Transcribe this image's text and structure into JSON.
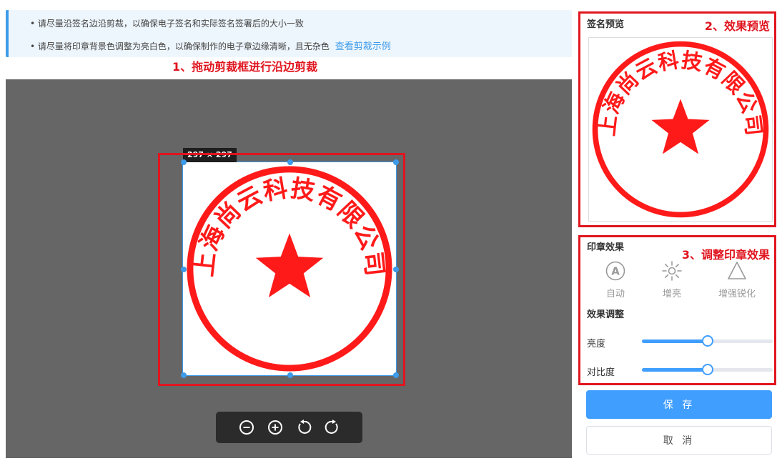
{
  "tips": {
    "line1": "• 请尽量沿签名边沿剪裁，以确保电子签名和实际签名签署后的大小一致",
    "line2": "• 请尽量将印章背景色调整为亮白色，以确保制作的电子章边缘清晰，且无杂色",
    "example_link": "查看剪裁示例"
  },
  "annotations": {
    "step1": "1、拖动剪裁框进行沿边剪裁",
    "step2": "2、效果预览",
    "step3": "3、调整印章效果"
  },
  "crop": {
    "dimensions": "297 × 297"
  },
  "seal": {
    "text": "上海尚云科技有限公司",
    "color": "#ff1a1a"
  },
  "toolbar": {
    "tools": [
      "zoom-out-icon",
      "zoom-in-icon",
      "rotate-left-icon",
      "rotate-right-icon"
    ]
  },
  "preview": {
    "title": "签名预览"
  },
  "effects": {
    "title": "印章效果",
    "options": [
      {
        "label": "自动",
        "icon": "auto-a-icon"
      },
      {
        "label": "增亮",
        "icon": "brightness-icon"
      },
      {
        "label": "增强锐化",
        "icon": "sharpen-triangle-icon"
      }
    ],
    "adjust_title": "效果调整",
    "brightness": {
      "label": "亮度",
      "value": 0.5
    },
    "contrast": {
      "label": "对比度",
      "value": 0.5
    }
  },
  "actions": {
    "save": "保 存",
    "cancel": "取 消"
  }
}
